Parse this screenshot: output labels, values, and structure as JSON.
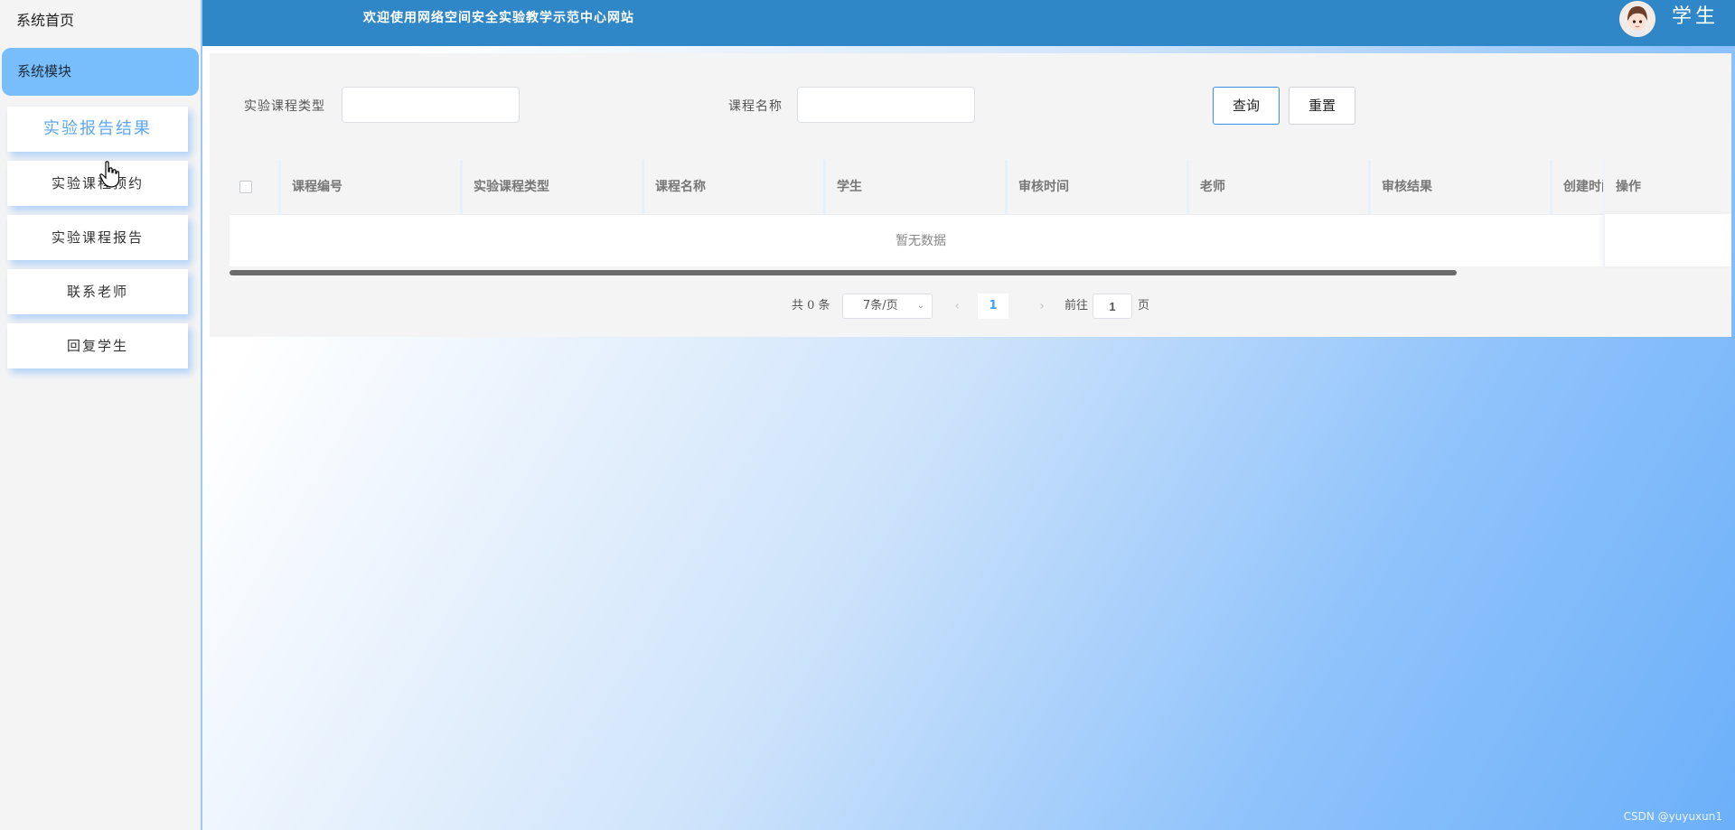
{
  "sidebar": {
    "home_label": "系统首页",
    "module_label": "系统模块",
    "items": [
      {
        "label": "实验报告结果"
      },
      {
        "label": "实验课程预约"
      },
      {
        "label": "实验课程报告"
      },
      {
        "label": "联系老师"
      },
      {
        "label": "回复学生"
      }
    ]
  },
  "header": {
    "title": "欢迎使用网络空间安全实验教学示范中心网站",
    "user_role": "学生"
  },
  "search": {
    "fields": [
      {
        "label": "实验课程类型",
        "value": "",
        "placeholder": ""
      },
      {
        "label": "课程名称",
        "value": "",
        "placeholder": ""
      }
    ],
    "query_label": "查询",
    "reset_label": "重置"
  },
  "table": {
    "columns": [
      "课程编号",
      "实验课程类型",
      "课程名称",
      "学生",
      "审核时间",
      "老师",
      "审核结果",
      "创建时间",
      "操作"
    ],
    "rows": [],
    "empty_text": "暂无数据"
  },
  "pagination": {
    "total_text": "共 0 条",
    "page_size_text": "7条/页",
    "current_page": "1",
    "goto_label": "前往",
    "jump_value": "1",
    "page_suffix": "页"
  },
  "watermark": "CSDN @yuyuxun1",
  "colors": {
    "header": "#2f87c8",
    "module_active": "#78befc",
    "primary": "#409eff"
  }
}
